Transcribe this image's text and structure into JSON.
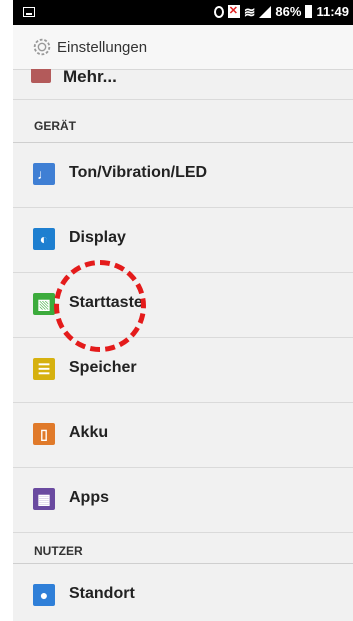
{
  "status_bar": {
    "battery": "86%",
    "time": "11:49"
  },
  "app_bar": {
    "title": "Einstellungen",
    "icon": "settings-gear-icon"
  },
  "list": {
    "partial_item": {
      "label": "Mehr...",
      "icon": "more-icon"
    },
    "section_device": "GERÄT",
    "device_items": [
      {
        "label": "Ton/Vibration/LED",
        "icon": "sound-icon",
        "color": "#3f7fd4"
      },
      {
        "label": "Display",
        "icon": "display-icon",
        "color": "#1e7fd0"
      },
      {
        "label": "Starttaste",
        "icon": "home-key-icon",
        "color": "#3cab3c"
      },
      {
        "label": "Speicher",
        "icon": "storage-icon",
        "color": "#d6b10f"
      },
      {
        "label": "Akku",
        "icon": "battery-icon",
        "color": "#e07a2a"
      },
      {
        "label": "Apps",
        "icon": "apps-icon",
        "color": "#6a4aa0"
      }
    ],
    "section_user": "NUTZER",
    "user_items": [
      {
        "label": "Standort",
        "icon": "location-icon",
        "color": "#2f7fd8"
      }
    ]
  },
  "highlight_color": "#e41b1b"
}
